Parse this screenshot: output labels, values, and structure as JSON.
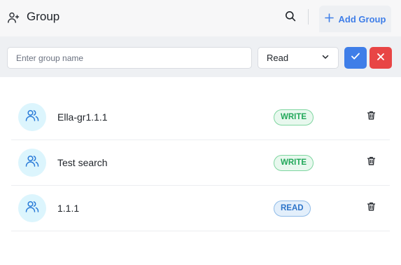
{
  "header": {
    "title": "Group",
    "title_icon": "user-plus-icon",
    "search_icon": "search-icon",
    "add_button": {
      "label": "Add Group",
      "icon": "plus-icon"
    }
  },
  "form": {
    "name_input": {
      "value": "",
      "placeholder": "Enter group name"
    },
    "permission_select": {
      "value": "Read",
      "icon": "chevron-down-icon"
    },
    "confirm_icon": "check-icon",
    "cancel_icon": "close-icon"
  },
  "groups": [
    {
      "name": "Ella-gr1.1.1",
      "permission": "WRITE",
      "avatar_icon": "users-icon",
      "delete_icon": "trash-icon"
    },
    {
      "name": "Test search",
      "permission": "WRITE",
      "avatar_icon": "users-icon",
      "delete_icon": "trash-icon"
    },
    {
      "name": "1.1.1",
      "permission": "READ",
      "avatar_icon": "users-icon",
      "delete_icon": "trash-icon"
    }
  ],
  "colors": {
    "accent": "#3f7ee8",
    "danger": "#e84545",
    "write_badge": "#22a85a",
    "read_badge": "#2d74c9",
    "avatar_bg": "#dcf5fd"
  }
}
